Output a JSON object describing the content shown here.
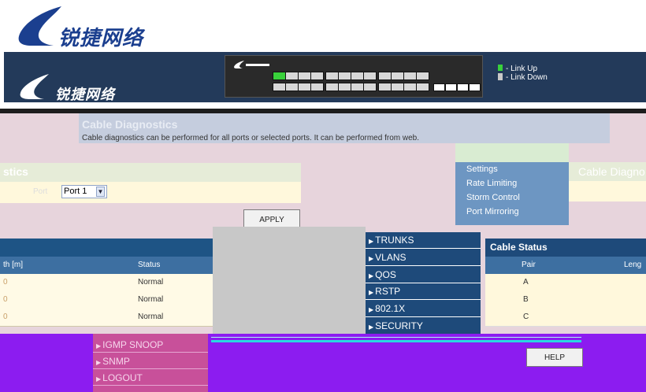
{
  "brand": {
    "name": "锐捷网络"
  },
  "switch": {
    "ports_top_up": [
      true,
      false,
      false,
      false,
      false,
      false,
      false,
      false,
      false,
      false,
      false,
      false
    ],
    "ports_bottom_up": [
      false,
      false,
      false,
      false,
      false,
      false,
      false,
      false,
      false,
      false,
      false,
      false
    ],
    "sfp_count": 4
  },
  "legend": {
    "up": "- Link Up",
    "down": "- Link Down",
    "up_color": "#39d13b",
    "down_color": "#c8c8c8"
  },
  "info": {
    "title": "Cable Diagnostics",
    "text": "Cable diagnostics can be performed for all ports or selected ports. It can be performed from web."
  },
  "form": {
    "header": "stics",
    "port_label": "Port",
    "port_value": "Port 1",
    "apply_label": "APPLY"
  },
  "menu": {
    "items": [
      "Settings",
      "Rate Limiting",
      "Storm Control",
      "Port Mirroring"
    ]
  },
  "right_header": "Cable Diagno",
  "table": {
    "col1": "th [m]",
    "col2": "Status",
    "rows": [
      {
        "length": "0",
        "status": "Normal"
      },
      {
        "length": "0",
        "status": "Normal"
      },
      {
        "length": "0",
        "status": "Normal"
      }
    ]
  },
  "nav": {
    "items": [
      "TRUNKS",
      "VLANS",
      "QOS",
      "RSTP",
      "802.1X",
      "SECURITY"
    ]
  },
  "cable_status": {
    "title": "Cable Status",
    "col_pair": "Pair",
    "col_length": "Leng",
    "pairs": [
      "A",
      "B",
      "C"
    ]
  },
  "bottom_nav": {
    "items": [
      "IGMP SNOOP",
      "SNMP",
      "LOGOUT"
    ]
  },
  "help_label": "HELP"
}
